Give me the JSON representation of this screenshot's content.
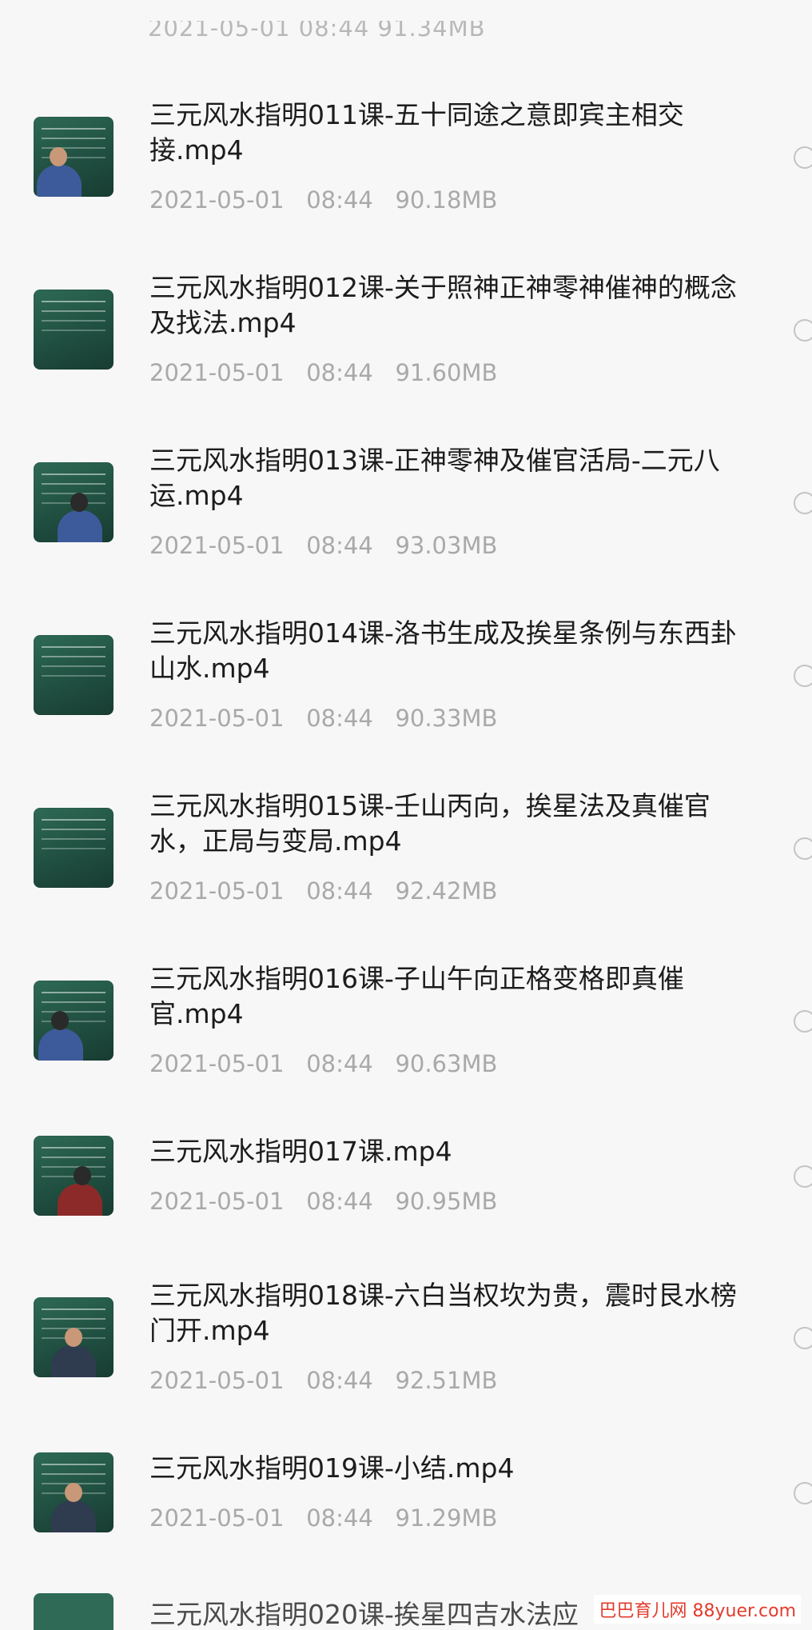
{
  "top_partial_meta": "2021-05-01   08:44   91.34MB",
  "files": [
    {
      "title": "三元风水指明011课-五十同途之意即宾主相交接.mp4",
      "date": "2021-05-01",
      "time": "08:44",
      "size": "90.18MB",
      "thumb": "lecturer-at-chalkboard"
    },
    {
      "title": "三元风水指明012课-关于照神正神零神催神的概念及找法.mp4",
      "date": "2021-05-01",
      "time": "08:44",
      "size": "91.60MB",
      "thumb": "chalkboard"
    },
    {
      "title": "三元风水指明013课-正神零神及催官活局-二元八运.mp4",
      "date": "2021-05-01",
      "time": "08:44",
      "size": "93.03MB",
      "thumb": "lecturer-back-at-chalkboard"
    },
    {
      "title": "三元风水指明014课-洛书生成及挨星条例与东西卦山水.mp4",
      "date": "2021-05-01",
      "time": "08:44",
      "size": "90.33MB",
      "thumb": "chalkboard-writing"
    },
    {
      "title": "三元风水指明015课-壬山丙向，挨星法及真催官水，正局与变局.mp4",
      "date": "2021-05-01",
      "time": "08:44",
      "size": "92.42MB",
      "thumb": "chalkboard-diagram"
    },
    {
      "title": "三元风水指明016课-子山午向正格变格即真催官.mp4",
      "date": "2021-05-01",
      "time": "08:44",
      "size": "90.63MB",
      "thumb": "lecturer-writing"
    },
    {
      "title": "三元风水指明017课.mp4",
      "date": "2021-05-01",
      "time": "08:44",
      "size": "90.95MB",
      "thumb": "lecturer-red-shirt"
    },
    {
      "title": "三元风水指明018课-六白当权坎为贵，震时艮水榜门开.mp4",
      "date": "2021-05-01",
      "time": "08:44",
      "size": "92.51MB",
      "thumb": "lecturer-front"
    },
    {
      "title": "三元风水指明019课-小结.mp4",
      "date": "2021-05-01",
      "time": "08:44",
      "size": "91.29MB",
      "thumb": "lecturer-front"
    }
  ],
  "bottom_partial_title": "三元风水指明020课-挨星四吉水法应",
  "watermark": {
    "site": "巴巴育儿网",
    "url": "88yuer.com"
  },
  "colors": {
    "background": "#f7f7f7",
    "title": "#1c1c1c",
    "meta": "#a9a9a9",
    "watermark": "#e23b2c"
  }
}
